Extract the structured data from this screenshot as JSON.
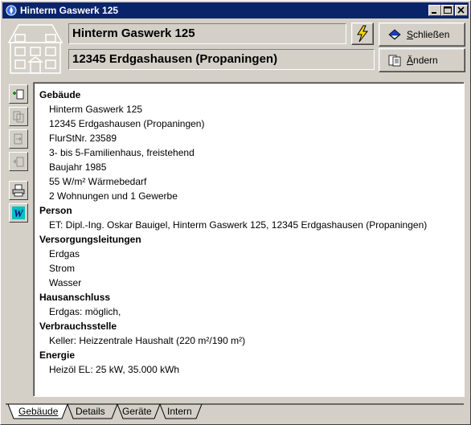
{
  "window": {
    "title": "Hinterm Gaswerk 125"
  },
  "header": {
    "street": "Hinterm Gaswerk 125",
    "city": "12345 Erdgashausen (Propaningen)",
    "close_label": "Schließen",
    "close_accesskey": "S",
    "edit_label": "Ändern",
    "edit_accesskey": "Ä"
  },
  "toolbar": {
    "items": [
      "add-icon",
      "copy-icon",
      "move-icon",
      "back-icon",
      "print-icon",
      "word-icon"
    ]
  },
  "sections": [
    {
      "title": "Gebäude",
      "lines": [
        "Hinterm Gaswerk 125",
        "12345 Erdgashausen (Propaningen)",
        "FlurStNr. 23589",
        "3- bis 5-Familienhaus, freistehend",
        "Baujahr 1985",
        "55 W/m² Wärmebedarf",
        "2 Wohnungen und 1 Gewerbe"
      ]
    },
    {
      "title": "Person",
      "lines": [
        "ET: Dipl.-Ing. Oskar Bauigel, Hinterm Gaswerk 125, 12345 Erdgashausen (Propaningen)"
      ]
    },
    {
      "title": "Versorgungsleitungen",
      "lines": [
        "Erdgas",
        "Strom",
        "Wasser"
      ]
    },
    {
      "title": "Hausanschluss",
      "lines": [
        "Erdgas: möglich,"
      ]
    },
    {
      "title": "Verbrauchsstelle",
      "lines": [
        "Keller: Heizzentrale Haushalt (220 m²/190 m²)"
      ]
    },
    {
      "title": "Energie",
      "lines": [
        "Heizöl EL: 25 kW, 35.000 kWh"
      ]
    }
  ],
  "tabs": [
    {
      "label": "Gebäude",
      "active": true
    },
    {
      "label": "Details",
      "active": false
    },
    {
      "label": "Geräte",
      "active": false
    },
    {
      "label": "Intern",
      "active": false
    }
  ],
  "colors": {
    "titlebar": "#0a246a",
    "face": "#d4d0c8",
    "lightning": "#f5d800"
  }
}
